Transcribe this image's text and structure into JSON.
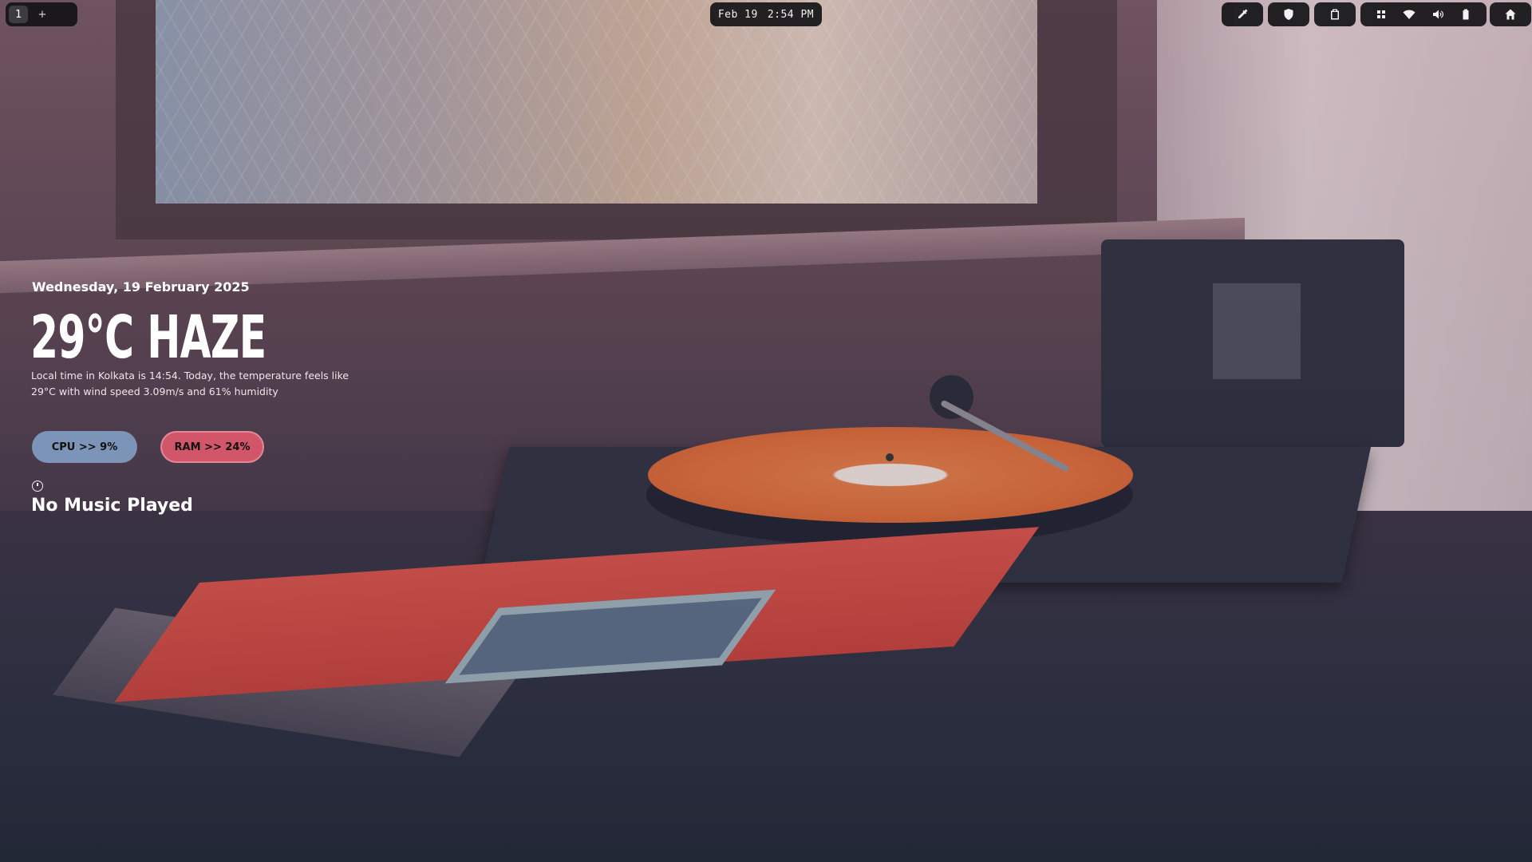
{
  "topbar": {
    "workspaces": {
      "active": "1",
      "add": "+"
    },
    "clock": {
      "date": "Feb 19",
      "time": "2:54 PM"
    },
    "icons": [
      "color-picker-icon",
      "shield-icon",
      "clipboard-icon",
      "grid-icon",
      "wifi-icon",
      "volume-icon",
      "battery-icon",
      "home-icon"
    ]
  },
  "weather": {
    "date": "Wednesday, 19 February 2025",
    "headline": "29°C HAZE",
    "description": "Local time in Kolkata is 14:54. Today, the temperature feels like 29°C with wind speed 3.09m/s and 61% humidity"
  },
  "stats": {
    "cpu": "CPU >> 9%",
    "ram": "RAM >> 24%"
  },
  "music": {
    "title": "No Music Played"
  },
  "colors": {
    "bar_bg": "#141416",
    "cpu_pill": "#7b94b8",
    "ram_pill": "#d2566a"
  }
}
